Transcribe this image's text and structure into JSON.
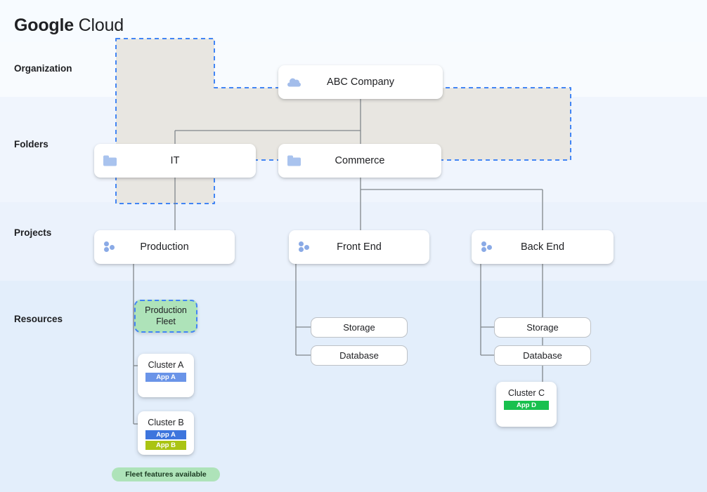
{
  "brand": {
    "primary_word": "Google",
    "secondary_word": "Cloud"
  },
  "tiers": [
    {
      "id": "organization",
      "label": "Organization"
    },
    {
      "id": "folders",
      "label": "Folders"
    },
    {
      "id": "projects",
      "label": "Projects"
    },
    {
      "id": "resources",
      "label": "Resources"
    }
  ],
  "organization": {
    "name": "ABC Company",
    "icon": "cloud-icon"
  },
  "folders": [
    {
      "name": "IT",
      "icon": "folder-icon"
    },
    {
      "name": "Commerce",
      "icon": "folder-icon"
    }
  ],
  "projects": [
    {
      "name": "Production",
      "icon": "project-dots-icon"
    },
    {
      "name": "Front End",
      "icon": "project-dots-icon"
    },
    {
      "name": "Back End",
      "icon": "project-dots-icon"
    }
  ],
  "resources": {
    "front_end": [
      {
        "name": "Storage"
      },
      {
        "name": "Database"
      }
    ],
    "back_end": [
      {
        "name": "Storage"
      },
      {
        "name": "Database"
      }
    ],
    "fleet": {
      "name": "Production Fleet",
      "name_line1": "Production",
      "name_line2": "Fleet",
      "badge": "Fleet features available",
      "clusters": [
        {
          "name": "Cluster A",
          "apps": [
            {
              "label": "App A",
              "color": "#6a94e8"
            }
          ]
        },
        {
          "name": "Cluster B",
          "apps": [
            {
              "label": "App A",
              "color": "#3d75dd"
            },
            {
              "label": "App B",
              "color": "#aac413"
            }
          ]
        },
        {
          "name": "Cluster C",
          "apps": [
            {
              "label": "App D",
              "color": "#18c04e"
            }
          ]
        }
      ]
    }
  },
  "colors": {
    "band_organization": "#f8fbfe",
    "band_folders": "#f0f5fd",
    "band_projects": "#ebf2fc",
    "band_resources": "#e3eefb",
    "connector": "#80868b",
    "fleet_fill": "#aee3b9",
    "fleet_dash": "#4285f4",
    "fleet_region_fill": "#e8e6e1",
    "icon_blue": "#a3bdeb"
  }
}
